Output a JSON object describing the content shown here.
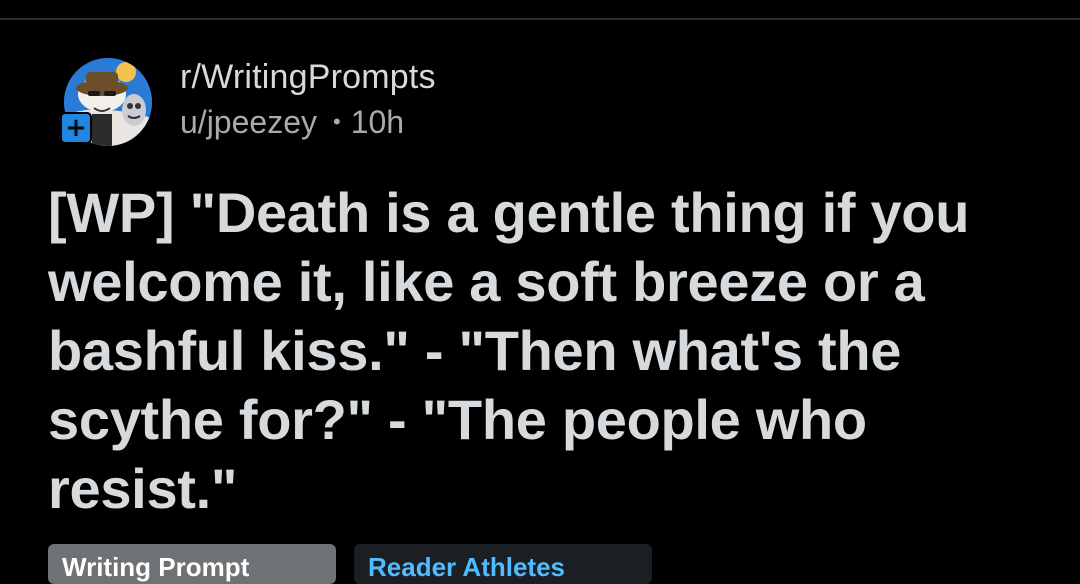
{
  "post": {
    "subreddit": "r/WritingPrompts",
    "author": "u/jpeezey",
    "separator": "•",
    "time_ago": "10h",
    "title": "[WP] \"Death is a gentle thing if you welcome it, like a soft breeze or a bashful kiss.\" - \"Then what's the scythe for?\" - \"The people who resist.\"",
    "join_symbol": "+"
  },
  "flairs": [
    {
      "label": "Writing Prompt"
    },
    {
      "label": "Reader Athletes"
    }
  ],
  "colors": {
    "background": "#000000",
    "text_primary": "#d7dadc",
    "text_secondary": "#a8aaab",
    "join_badge": "#1f86e2",
    "flair_1_bg": "#6f7274",
    "flair_2_text": "#4fbcff"
  },
  "icons": {
    "avatar": "subreddit-avatar-icon",
    "join": "plus-icon"
  }
}
